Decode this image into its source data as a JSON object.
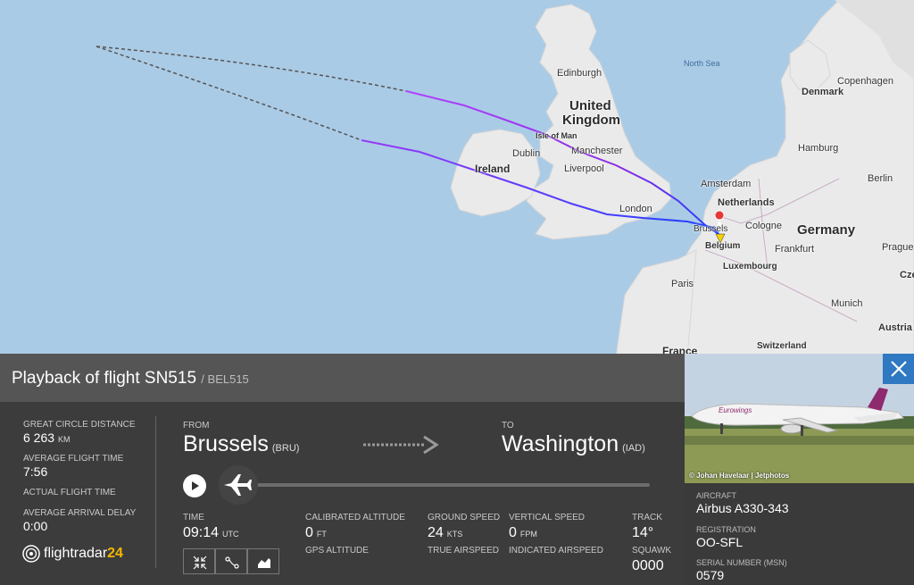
{
  "map": {
    "labels": {
      "north_sea": "North Sea",
      "edinburgh": "Edinburgh",
      "united_kingdom": "United Kingdom",
      "isle_of_man": "Isle of Man",
      "dublin": "Dublin",
      "manchester": "Manchester",
      "liverpool": "Liverpool",
      "ireland": "Ireland",
      "london": "London",
      "denmark": "Denmark",
      "copenhagen": "Copenhagen",
      "hamburg": "Hamburg",
      "amsterdam": "Amsterdam",
      "netherlands": "Netherlands",
      "berlin": "Berlin",
      "germany": "Germany",
      "cologne": "Cologne",
      "brussels": "Brussels",
      "belgium": "Belgium",
      "frankfurt": "Frankfurt",
      "luxembourg": "Luxembourg",
      "prague": "Prague",
      "czech": "Cze",
      "paris": "Paris",
      "munich": "Munich",
      "austria": "Austria",
      "switzerland": "Switzerland",
      "france": "France"
    },
    "colors": {
      "sea": "#aacbe6",
      "land": "#eaeaea",
      "track_start": "#1e40ff",
      "track_end": "#b044ff",
      "dashed": "#555555"
    }
  },
  "panel": {
    "title": "Playback of flight SN515",
    "callsign": "/ BEL515",
    "great_circle_distance_label": "GREAT CIRCLE DISTANCE",
    "great_circle_distance_value": "6 263",
    "great_circle_distance_unit": "KM",
    "average_flight_time_label": "AVERAGE FLIGHT TIME",
    "average_flight_time_value": "7:56",
    "actual_flight_time_label": "ACTUAL FLIGHT TIME",
    "average_arrival_delay_label": "AVERAGE ARRIVAL DELAY",
    "average_arrival_delay_value": "0:00",
    "logo_text": "flightradar",
    "logo_num": "24",
    "from_label": "FROM",
    "from_city": "Brussels",
    "from_code": "(BRU)",
    "to_label": "TO",
    "to_city": "Washington",
    "to_code": "(IAD)",
    "time_label": "TIME",
    "time_value": "09:14",
    "time_unit": "UTC",
    "calibrated_altitude_label": "CALIBRATED ALTITUDE",
    "calibrated_altitude_value": "0",
    "calibrated_altitude_unit": "FT",
    "gps_altitude_label": "GPS ALTITUDE",
    "ground_speed_label": "GROUND SPEED",
    "ground_speed_value": "24",
    "ground_speed_unit": "KTS",
    "true_airspeed_label": "TRUE AIRSPEED",
    "vertical_speed_label": "VERTICAL SPEED",
    "vertical_speed_value": "0",
    "vertical_speed_unit": "FPM",
    "indicated_airspeed_label": "INDICATED AIRSPEED",
    "track_label": "TRACK",
    "track_value": "14°",
    "squawk_label": "SQUAWK",
    "squawk_value": "0000",
    "playback_progress": 0.0
  },
  "aircraft": {
    "photo_credit": "© Johan Havelaar | Jetphotos",
    "aircraft_label": "AIRCRAFT",
    "aircraft_value": "Airbus A330-343",
    "registration_label": "REGISTRATION",
    "registration_value": "OO-SFL",
    "serial_label": "SERIAL NUMBER (MSN)",
    "serial_value": "0579",
    "livery_text": "Eurowings"
  }
}
